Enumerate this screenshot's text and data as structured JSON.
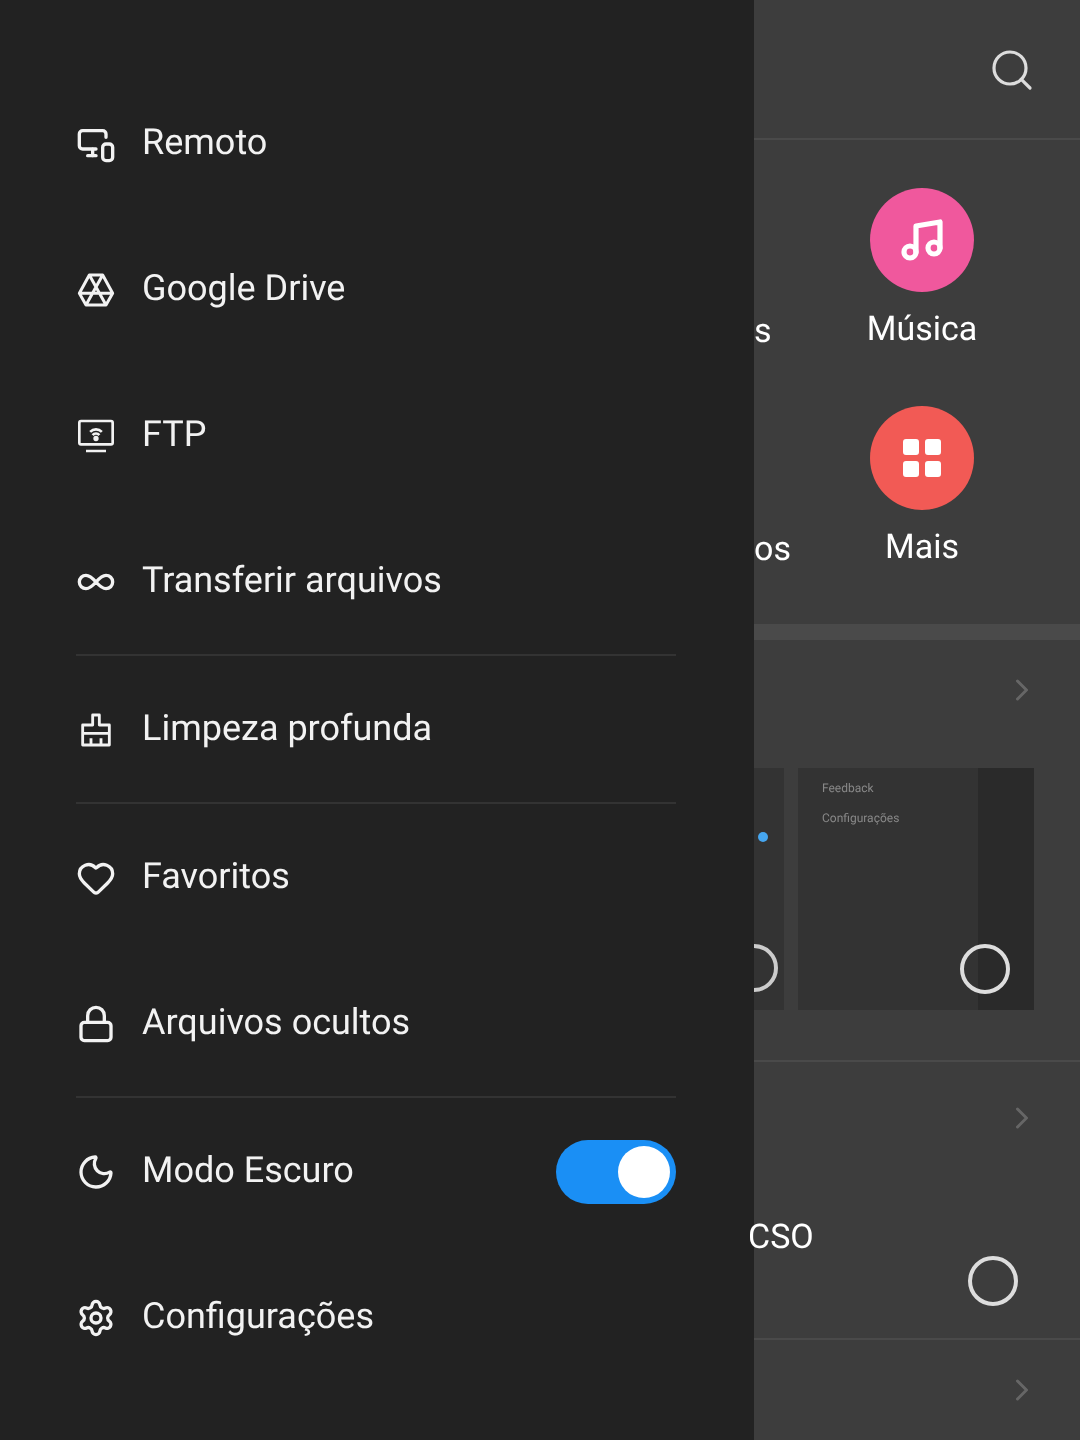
{
  "drawer": {
    "groups": [
      [
        {
          "kind": "link",
          "label": "Remoto"
        },
        {
          "kind": "link",
          "label": "Google Drive"
        },
        {
          "kind": "link",
          "label": "FTP"
        },
        {
          "kind": "link",
          "label": "Transferir arquivos"
        }
      ],
      [
        {
          "kind": "link",
          "label": "Limpeza profunda"
        }
      ],
      [
        {
          "kind": "link",
          "label": "Favoritos"
        },
        {
          "kind": "link",
          "label": "Arquivos ocultos"
        }
      ],
      [
        {
          "kind": "toggle",
          "label": "Modo Escuro",
          "on": true
        },
        {
          "kind": "link",
          "label": "Configurações"
        }
      ]
    ]
  },
  "background": {
    "categories": [
      {
        "cut_label": "s",
        "label": "Música",
        "color": "#f0589d"
      },
      {
        "cut_label": "os",
        "label": "Mais",
        "color": "#f25a55"
      }
    ],
    "thumbnail_menu": [
      "Feedback",
      "Configurações"
    ],
    "cut_text": "CSO"
  }
}
